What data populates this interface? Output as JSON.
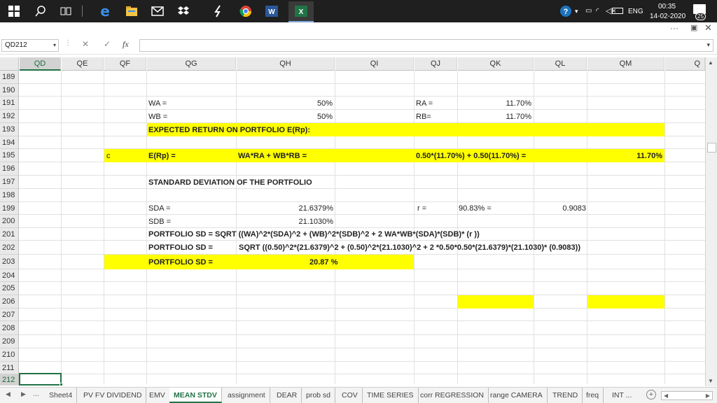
{
  "taskbar": {
    "icons": [
      "windows-start-icon",
      "search-icon",
      "task-view-icon",
      "edge-browser-icon",
      "file-explorer-icon",
      "mail-icon",
      "dropbox-icon",
      "winamp-icon",
      "chrome-icon",
      "word-icon",
      "excel-icon"
    ],
    "language": "ENG",
    "time": "00:35",
    "date": "14-02-2020",
    "notification_count": "25"
  },
  "window": {
    "more": "···"
  },
  "formula_bar": {
    "namebox": "QD212",
    "cancel_icon": "✕",
    "enter_icon": "✓",
    "fx_label": "fx",
    "value": ""
  },
  "columns": [
    "QD",
    "QE",
    "QF",
    "QG",
    "QH",
    "QI",
    "QJ",
    "QK",
    "QL",
    "QM",
    "Q"
  ],
  "rows": [
    "189",
    "190",
    "191",
    "192",
    "193",
    "194",
    "195",
    "196",
    "197",
    "198",
    "199",
    "200",
    "201",
    "202",
    "203",
    "204",
    "205",
    "206",
    "207",
    "208",
    "209",
    "210",
    "211",
    "212"
  ],
  "cells": {
    "wa_label": "WA =",
    "wa_value": "50%",
    "ra_label": "RA =",
    "ra_value": "11.70%",
    "wb_label": "WB =",
    "wb_value": "50%",
    "rb_label": "RB=",
    "rb_value": "11.70%",
    "expected_return_heading": "EXPECTED RETURN ON PORTFOLIO E(Rp):",
    "c_label": "c",
    "erp_label": "E(Rp) =",
    "erp_formula": "WA*RA + WB*RB =",
    "erp_substituted": "0.50*(11.70%) + 0.50(11.70%) =",
    "erp_result": "11.70%",
    "sd_heading": "STANDARD DEVIATION OF THE PORTFOLIO",
    "sda_label": "SDA =",
    "sda_value": "21.6379%",
    "r_label": "r =",
    "r_percent": "90.83% =",
    "r_value": "0.9083",
    "sdb_label": "SDB =",
    "sdb_value": "21.1030%",
    "portfolio_sd_formula": "PORTFOLIO SD = SQRT ((WA)^2*(SDA)^2 + (WB)^2*(SDB)^2 + 2 WA*WB*(SDA)*(SDB)* (r ))",
    "portfolio_sd_label2": "PORTFOLIO SD =",
    "portfolio_sd_substituted": "SQRT ((0.50)^2*(21.6379)^2 + (0.50)^2*(21.1030)^2 + 2 *0.50*0.50*(21.6379)*(21.1030)* (0.9083))",
    "portfolio_sd_label3": "PORTFOLIO SD =",
    "portfolio_sd_result": "20.87 %"
  },
  "sheet_tabs": {
    "ellipsis": "...",
    "tabs": [
      "Sheet4",
      "PV FV DIVIDEND",
      "EMV",
      "MEAN STDV",
      "assignment",
      "DEAR",
      "prob sd",
      "COV",
      "TIME SERIES",
      "corr REGRESSION",
      "range CAMERA",
      "TREND",
      "freq",
      "INT ..."
    ],
    "active": "MEAN STDV"
  },
  "colors": {
    "highlight": "#ffff00",
    "excel_green": "#217346"
  }
}
